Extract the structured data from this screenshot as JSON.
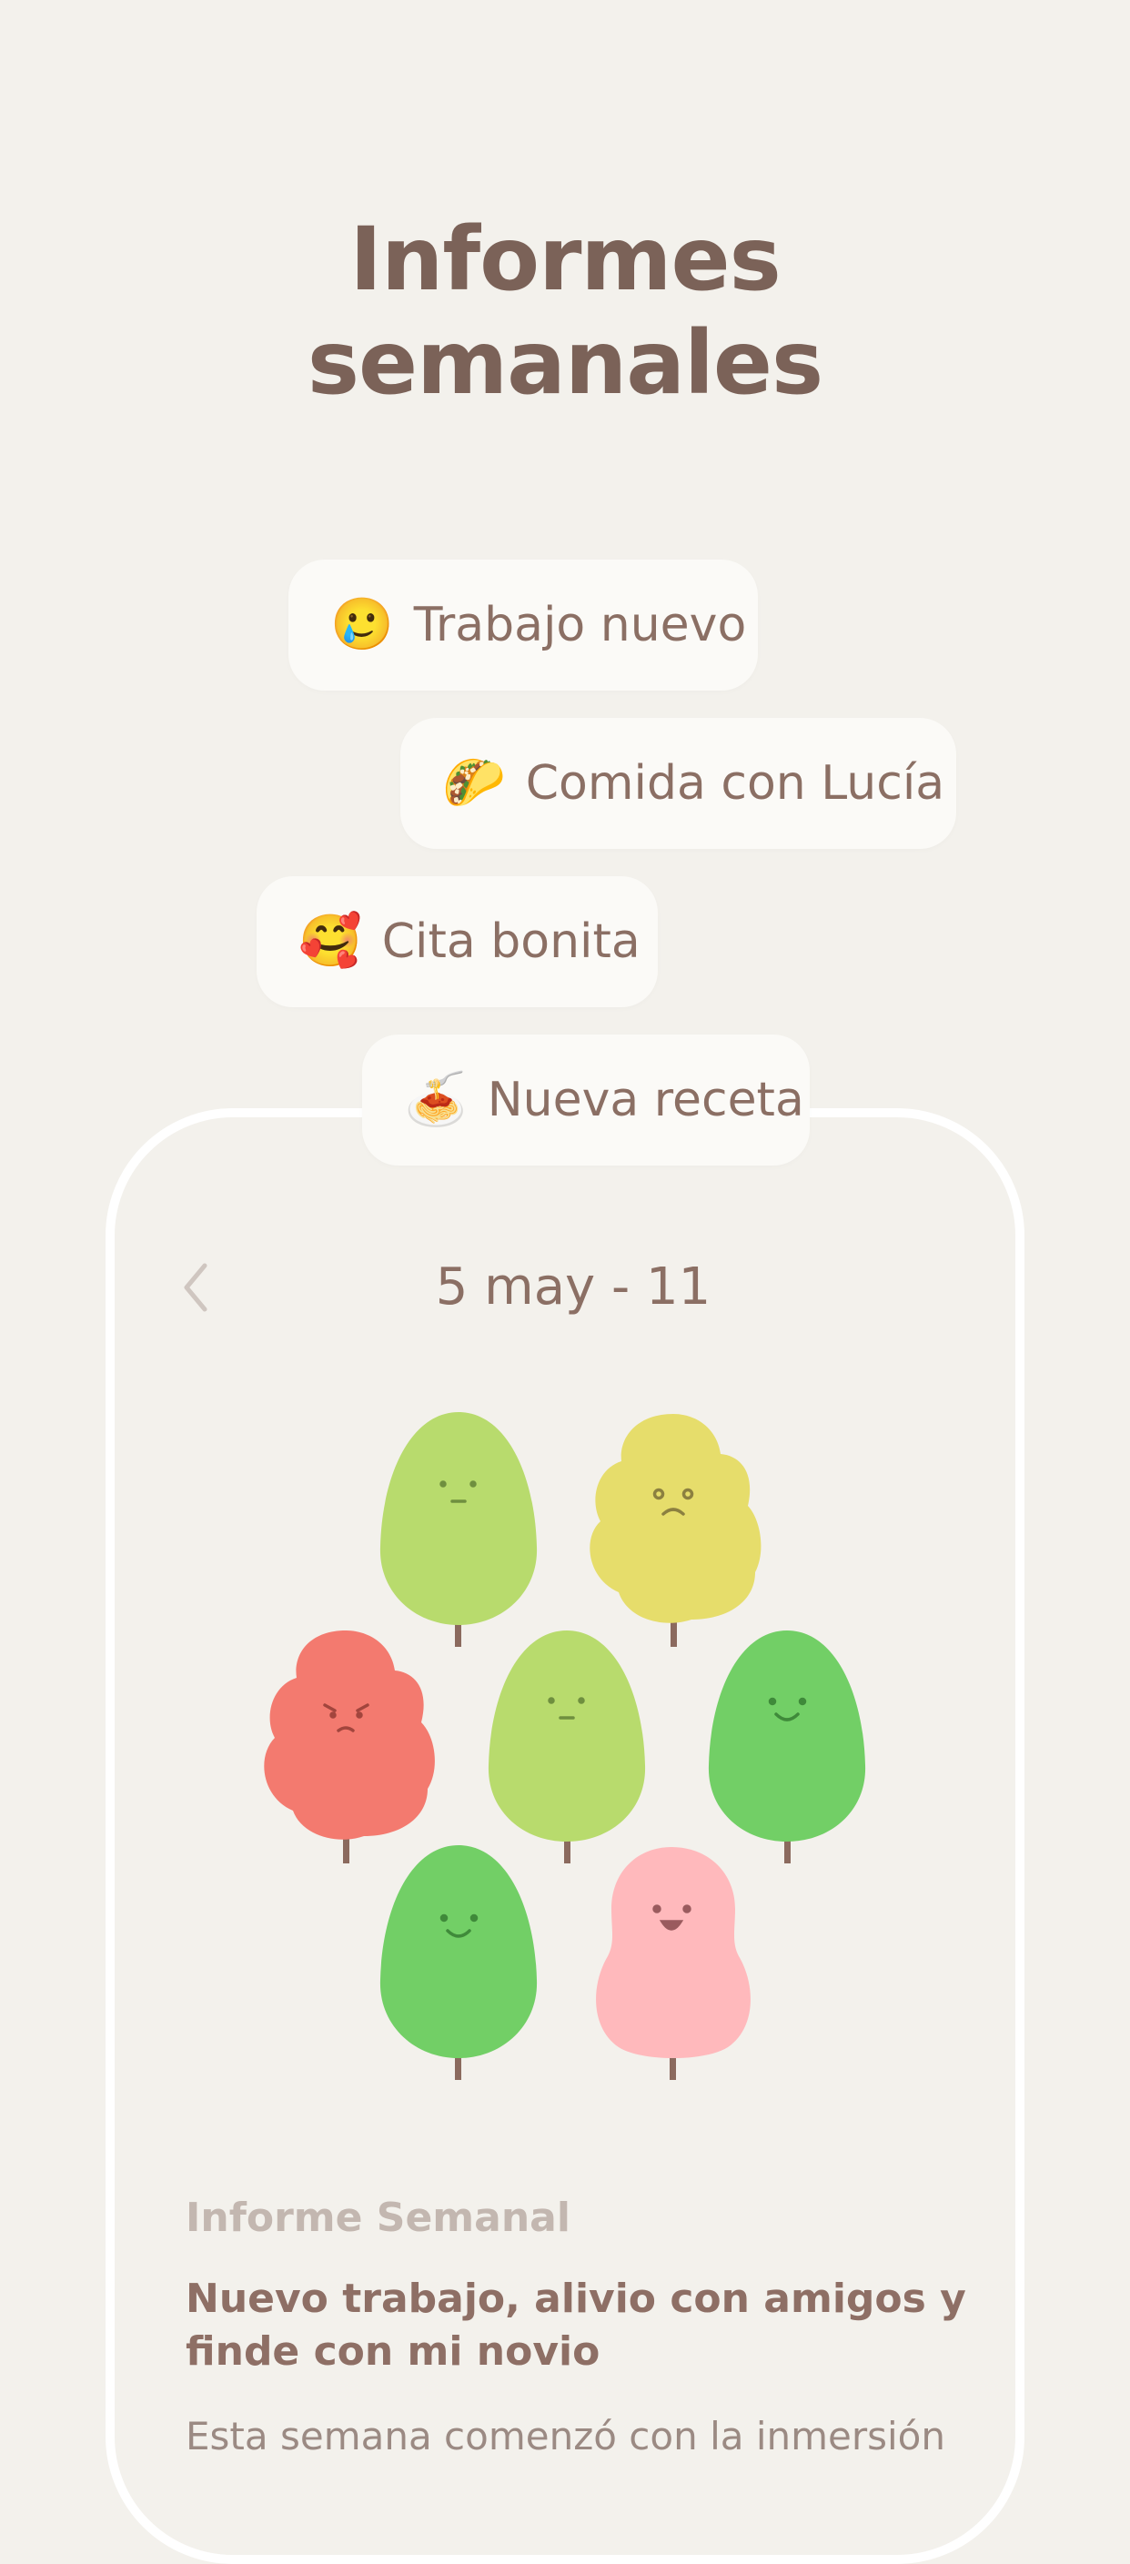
{
  "header": {
    "title_line1": "Informes",
    "title_line2": "semanales"
  },
  "chips": [
    {
      "emoji": "🥲",
      "label": "Trabajo nuevo"
    },
    {
      "emoji": "🌮",
      "label": "Comida con Lucía"
    },
    {
      "emoji": "🥰",
      "label": "Cita bonita"
    },
    {
      "emoji": "🍝",
      "label": "Nueva receta"
    }
  ],
  "week": {
    "range": "5 may - 11",
    "back_icon": "chevron-left-icon"
  },
  "trees": [
    {
      "name": "tree-1",
      "mood": "neutral",
      "color": "#b8db6d"
    },
    {
      "name": "tree-2",
      "mood": "sad",
      "color": "#e6dd6b"
    },
    {
      "name": "tree-3",
      "mood": "angry",
      "color": "#f37a6f"
    },
    {
      "name": "tree-4",
      "mood": "neutral",
      "color": "#b8db6d"
    },
    {
      "name": "tree-5",
      "mood": "happy",
      "color": "#72cf66"
    },
    {
      "name": "tree-6",
      "mood": "happy",
      "color": "#72cf66"
    },
    {
      "name": "tree-7",
      "mood": "joyful",
      "color": "#ffb9bc"
    }
  ],
  "report": {
    "label": "Informe Semanal",
    "title": "Nuevo trabajo, alivio con amigos y finde con mi novio",
    "body": "Esta semana comenzó con la inmersión"
  },
  "colors": {
    "background": "#f3f1ec",
    "chip": "#fbfaf7",
    "text": "#7b6258",
    "trunk": "#8b6a5e"
  }
}
